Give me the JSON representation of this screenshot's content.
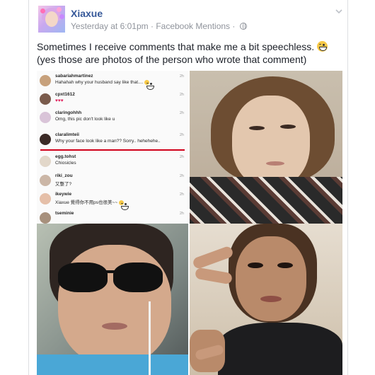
{
  "post": {
    "author": "Xiaxue",
    "timestamp": "Yesterday at 6:01pm",
    "source": "Facebook Mentions",
    "separator": "·",
    "status_text": "Sometimes I receive comments that make me a bit speechless.",
    "status_text_after": "(yes those are photos of the person who wrote that comment)"
  },
  "comments": [
    {
      "user": "sabariahmartinez",
      "text": "Hahahah why your husband say like that....",
      "time": "2h"
    },
    {
      "user": "cpxt1612",
      "text": "♥♥♥",
      "time": "2h"
    },
    {
      "user": "claringohhh",
      "text": "Omg, this pic don't look like u",
      "time": "2h"
    },
    {
      "user": "claralimteii",
      "text": "Why your face look like a man?? Sorry.. hehehehe..",
      "time": "2h"
    },
    {
      "user": "egg.tohst",
      "text": "Chiosicles",
      "time": "2h"
    },
    {
      "user": "riki_zou",
      "text": "又整了?",
      "time": "2h"
    },
    {
      "user": "ikeywie",
      "text": "Xiaxue 覺得你不用ps也很美~~",
      "time": "2h"
    },
    {
      "user": "tseminie",
      "text": "",
      "time": "2h"
    }
  ],
  "colors": {
    "link": "#365899",
    "meta": "#90949c",
    "highlight": "#d0021b"
  },
  "icons": {
    "globe": "globe-icon",
    "chevron": "chevron-down-icon"
  }
}
